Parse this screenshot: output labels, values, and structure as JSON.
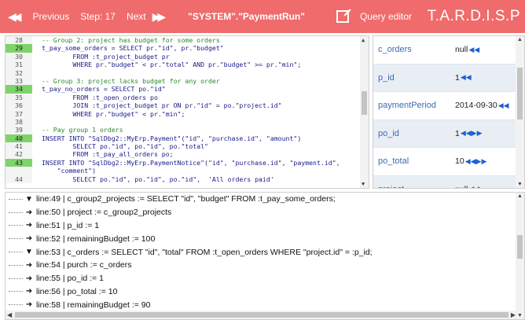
{
  "toolbar": {
    "prev_icon": "previous-double-arrow-icon",
    "prev_label": "Previous",
    "step_label": "Step: 17",
    "next_label": "Next",
    "next_icon": "next-double-arrow-icon",
    "target": "\"SYSTEM\".\"PaymentRun\"",
    "query_icon": "edit-square-icon",
    "query_label": "Query editor",
    "brand": "T.A.R.D.I.S.P"
  },
  "code": {
    "lines": [
      {
        "n": "28",
        "t": "-- Group 2: project has budget for some orders",
        "hl": false,
        "c": true
      },
      {
        "n": "29",
        "t": "t_pay_some_orders = SELECT pr.\"id\", pr.\"budget\"",
        "hl": true,
        "c": false
      },
      {
        "n": "30",
        "t": "        FROM :t_project_budget pr",
        "hl": false,
        "c": false
      },
      {
        "n": "31",
        "t": "        WHERE pr.\"budget\" < pr.\"total\" AND pr.\"budget\" >= pr.\"min\";",
        "hl": false,
        "c": false
      },
      {
        "n": "32",
        "t": "",
        "hl": false,
        "c": false
      },
      {
        "n": "33",
        "t": "-- Group 3: project lacks budget for any order",
        "hl": false,
        "c": true
      },
      {
        "n": "34",
        "t": "t_pay_no_orders = SELECT po.\"id\"",
        "hl": true,
        "c": false
      },
      {
        "n": "35",
        "t": "        FROM :t_open_orders po",
        "hl": false,
        "c": false
      },
      {
        "n": "36",
        "t": "        JOIN :t_project_budget pr ON pr.\"id\" = po.\"project.id\"",
        "hl": false,
        "c": false
      },
      {
        "n": "37",
        "t": "        WHERE pr.\"budget\" < pr.\"min\";",
        "hl": false,
        "c": false
      },
      {
        "n": "38",
        "t": "",
        "hl": false,
        "c": false
      },
      {
        "n": "39",
        "t": "-- Pay group 1 orders",
        "hl": false,
        "c": true
      },
      {
        "n": "40",
        "t": "INSERT INTO \"SqlDbg2::MyErp.Payment\"(\"id\", \"purchase.id\", \"amount\")",
        "hl": true,
        "c": false
      },
      {
        "n": "41",
        "t": "        SELECT po.\"id\", po.\"id\", po.\"total\"",
        "hl": false,
        "c": false
      },
      {
        "n": "42",
        "t": "        FROM :t_pay_all_orders po;",
        "hl": false,
        "c": false
      },
      {
        "n": "43",
        "t": "INSERT INTO \"SqlDbg2::MyErp.PaymentNotice\"(\"id\", \"purchase.id\", \"payment.id\",",
        "hl": true,
        "c": false
      },
      {
        "n": "",
        "t": "    \"comment\")",
        "hl": false,
        "c": false
      },
      {
        "n": "44",
        "t": "        SELECT po.\"id\", po.\"id\", po.\"id\",  'All orders paid'",
        "hl": false,
        "c": false
      }
    ]
  },
  "vars": [
    {
      "name": "c_orders",
      "value": "null",
      "mark": "◀◀"
    },
    {
      "name": "p_id",
      "value": "1",
      "mark": "◀◀"
    },
    {
      "name": "paymentPeriod",
      "value": "2014-09-30",
      "mark": "◀◀"
    },
    {
      "name": "po_id",
      "value": "1",
      "mark": "◀◀▶▶"
    },
    {
      "name": "po_total",
      "value": "10",
      "mark": "◀◀▶▶"
    },
    {
      "name": "project",
      "value": "null",
      "mark": "◀◀"
    }
  ],
  "trace": [
    {
      "icon": "filter-icon",
      "glyph": "▼",
      "text": "line:49 | c_group2_projects := SELECT \"id\", \"budget\" FROM :t_pay_some_orders;"
    },
    {
      "icon": "arrow-right-icon",
      "glyph": "➜",
      "text": "line:50 | project := c_group2_projects"
    },
    {
      "icon": "arrow-right-icon",
      "glyph": "➜",
      "text": "line:51 | p_id := 1"
    },
    {
      "icon": "arrow-right-icon",
      "glyph": "➜",
      "text": "line:52 | remainingBudget := 100"
    },
    {
      "icon": "filter-icon",
      "glyph": "▼",
      "text": "line:53 | c_orders := SELECT \"id\", \"total\" FROM :t_open_orders WHERE \"project.id\" = :p_id;"
    },
    {
      "icon": "arrow-right-icon",
      "glyph": "➜",
      "text": "line:54 | purch := c_orders"
    },
    {
      "icon": "arrow-right-icon",
      "glyph": "➜",
      "text": "line:55 | po_id := 1"
    },
    {
      "icon": "arrow-right-icon",
      "glyph": "➜",
      "text": "line:56 | po_total := 10"
    },
    {
      "icon": "arrow-right-icon",
      "glyph": "➜",
      "text": "line:58 | remainingBudget := 90"
    }
  ],
  "colors": {
    "accent": "#f06b6b",
    "highlight_line": "#7fd36b",
    "var_name": "#3d6bb3",
    "comment": "#2a8a2a"
  }
}
